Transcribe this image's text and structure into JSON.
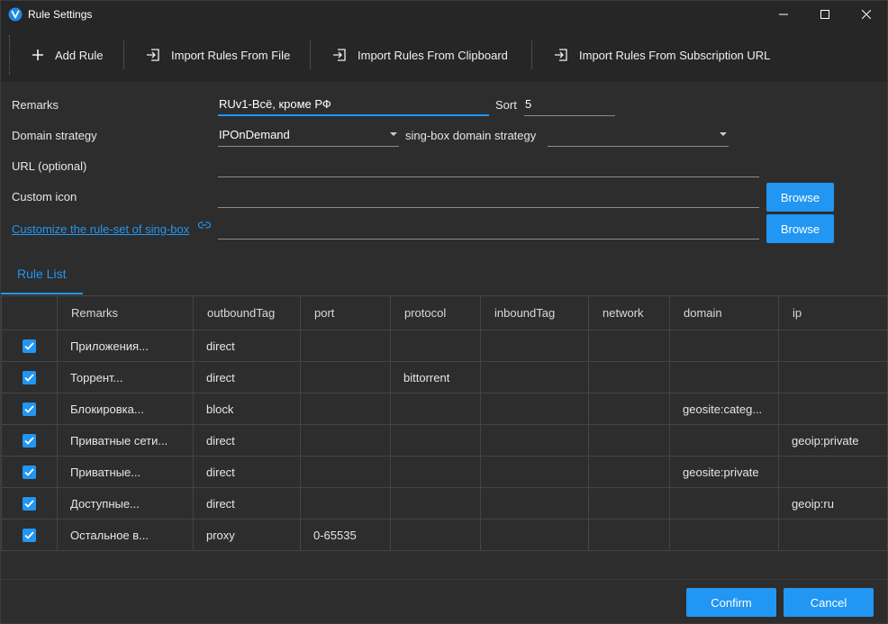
{
  "window": {
    "title": "Rule Settings",
    "icons": {
      "app": "v-logo-icon",
      "minimize": "minimize-icon",
      "maximize": "maximize-icon",
      "close": "close-icon"
    }
  },
  "toolbar": {
    "add_rule": "Add Rule",
    "import_file": "Import Rules From File",
    "import_clipboard": "Import Rules From Clipboard",
    "import_subscription": "Import Rules From Subscription URL"
  },
  "form": {
    "remarks_label": "Remarks",
    "remarks_value": "RUv1-Всё, кроме РФ",
    "sort_label": "Sort",
    "sort_value": "5",
    "domain_strategy_label": "Domain strategy",
    "domain_strategy_value": "IPOnDemand",
    "singbox_strategy_label": "sing-box domain strategy",
    "singbox_strategy_value": "",
    "url_label": "URL (optional)",
    "url_value": "",
    "custom_icon_label": "Custom icon",
    "custom_icon_value": "",
    "browse_label": "Browse",
    "ruleset_link": "Customize the rule-set of sing-box",
    "ruleset_value": "",
    "browse2_label": "Browse"
  },
  "tabs": [
    {
      "label": "Rule List",
      "active": true
    }
  ],
  "table": {
    "headers": [
      "",
      "Remarks",
      "outboundTag",
      "port",
      "protocol",
      "inboundTag",
      "network",
      "domain",
      "ip"
    ],
    "rows": [
      {
        "checked": true,
        "remarks": "Приложения...",
        "outboundTag": "direct",
        "port": "",
        "protocol": "",
        "inboundTag": "",
        "network": "",
        "domain": "",
        "ip": ""
      },
      {
        "checked": true,
        "remarks": "Торрент...",
        "outboundTag": "direct",
        "port": "",
        "protocol": "bittorrent",
        "inboundTag": "",
        "network": "",
        "domain": "",
        "ip": ""
      },
      {
        "checked": true,
        "remarks": "Блокировка...",
        "outboundTag": "block",
        "port": "",
        "protocol": "",
        "inboundTag": "",
        "network": "",
        "domain": "geosite:categ...",
        "ip": ""
      },
      {
        "checked": true,
        "remarks": "Приватные сети...",
        "outboundTag": "direct",
        "port": "",
        "protocol": "",
        "inboundTag": "",
        "network": "",
        "domain": "",
        "ip": "geoip:private"
      },
      {
        "checked": true,
        "remarks": "Приватные...",
        "outboundTag": "direct",
        "port": "",
        "protocol": "",
        "inboundTag": "",
        "network": "",
        "domain": "geosite:private",
        "ip": ""
      },
      {
        "checked": true,
        "remarks": "Доступные...",
        "outboundTag": "direct",
        "port": "",
        "protocol": "",
        "inboundTag": "",
        "network": "",
        "domain": "",
        "ip": "geoip:ru"
      },
      {
        "checked": true,
        "remarks": "Остальное в...",
        "outboundTag": "proxy",
        "port": "0-65535",
        "protocol": "",
        "inboundTag": "",
        "network": "",
        "domain": "",
        "ip": ""
      }
    ]
  },
  "footer": {
    "confirm": "Confirm",
    "cancel": "Cancel"
  },
  "colors": {
    "accent": "#2196f3",
    "background": "#2d2d2d",
    "toolbar": "#262626"
  }
}
